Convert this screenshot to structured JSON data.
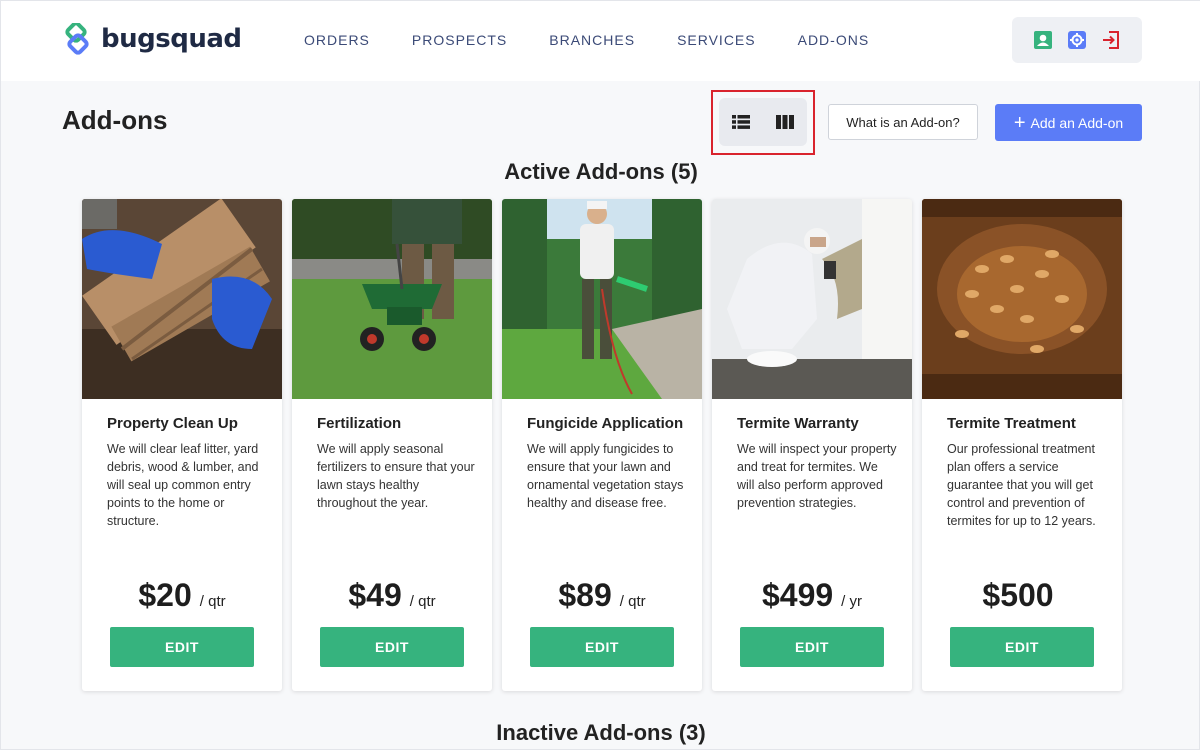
{
  "brand": {
    "name": "bugsquad",
    "logo_icon": "bugsquad-logo-icon",
    "colors": {
      "green": "#36b37e",
      "blue": "#5b7cf7"
    }
  },
  "nav": {
    "items": [
      {
        "label": "ORDERS"
      },
      {
        "label": "PROSPECTS"
      },
      {
        "label": "BRANCHES"
      },
      {
        "label": "SERVICES"
      },
      {
        "label": "ADD-ONS"
      }
    ]
  },
  "header_icons": [
    {
      "icon": "user-icon",
      "color": "#36b37e"
    },
    {
      "icon": "gear-icon",
      "color": "#5b7cf7"
    },
    {
      "icon": "logout-icon",
      "color": "#d9232d"
    }
  ],
  "page": {
    "title": "Add-ons"
  },
  "view_toggle": {
    "list_icon": "list-view-icon",
    "column_icon": "column-view-icon"
  },
  "what_button": {
    "label": "What is an Add-on?"
  },
  "add_button": {
    "label": "Add an Add-on"
  },
  "active_section": {
    "title": "Active Add-ons (5)"
  },
  "inactive_section": {
    "title": "Inactive Add-ons (3)"
  },
  "addons": [
    {
      "name": "Property Clean Up",
      "description": "We will clear leaf litter, yard debris, wood & lumber, and will seal up common entry points to the home or structure.",
      "price": "$20",
      "unit": "/ qtr",
      "edit_label": "EDIT"
    },
    {
      "name": "Fertilization",
      "description": "We will apply seasonal fertilizers to ensure that your lawn stays healthy throughout the year.",
      "price": "$49",
      "unit": "/ qtr",
      "edit_label": "EDIT"
    },
    {
      "name": "Fungicide Application",
      "description": "We will apply fungicides to ensure that your lawn and ornamental vegetation stays healthy and disease free.",
      "price": "$89",
      "unit": "/ qtr",
      "edit_label": "EDIT"
    },
    {
      "name": "Termite Warranty",
      "description": "We will inspect your property and treat for termites. We will also perform approved prevention strategies.",
      "price": "$499",
      "unit": "/ yr",
      "edit_label": "EDIT"
    },
    {
      "name": "Termite Treatment",
      "description": "Our professional treatment plan offers a service guarantee that you will get control and prevention of termites for up to 12 years.",
      "price": "$500",
      "unit": "",
      "edit_label": "EDIT"
    }
  ]
}
